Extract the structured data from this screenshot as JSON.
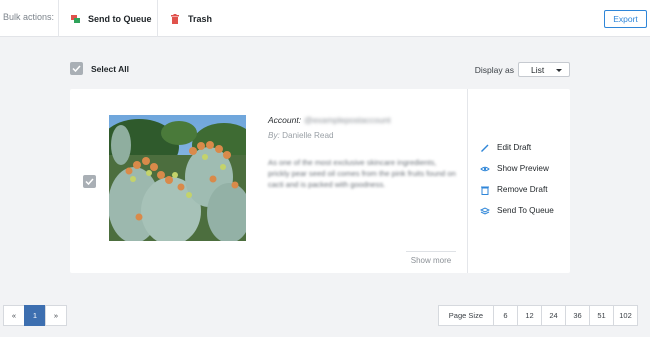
{
  "toolbar": {
    "bulk_label": "Bulk actions:",
    "send_to_queue": "Send to Queue",
    "trash": "Trash",
    "export": "Export"
  },
  "list_header": {
    "select_all": "Select All",
    "display_as_label": "Display as",
    "display_as_value": "List"
  },
  "draft": {
    "account_label": "Account:",
    "account_handle": "@examplepostaccount",
    "by_label": "By:",
    "author": "Danielle Read",
    "excerpt": "As one of the most exclusive skincare ingredients, prickly pear seed oil comes from the pink fruits found on cacti and is packed with goodness.",
    "show_more": "Show more",
    "image_alt": "prickly pear cactus photo",
    "actions": [
      {
        "label": "Edit Draft",
        "icon": "pencil-icon"
      },
      {
        "label": "Show Preview",
        "icon": "eye-icon"
      },
      {
        "label": "Remove Draft",
        "icon": "trash-icon"
      },
      {
        "label": "Send To Queue",
        "icon": "layers-icon"
      }
    ]
  },
  "pagination": {
    "prev": "«",
    "current": "1",
    "next": "»"
  },
  "page_size": {
    "label": "Page Size",
    "options": [
      "6",
      "12",
      "24",
      "36",
      "51",
      "102"
    ]
  },
  "colors": {
    "accent": "#2f86d8",
    "active_page": "#3d6fb0",
    "background": "#f2f3f5"
  }
}
